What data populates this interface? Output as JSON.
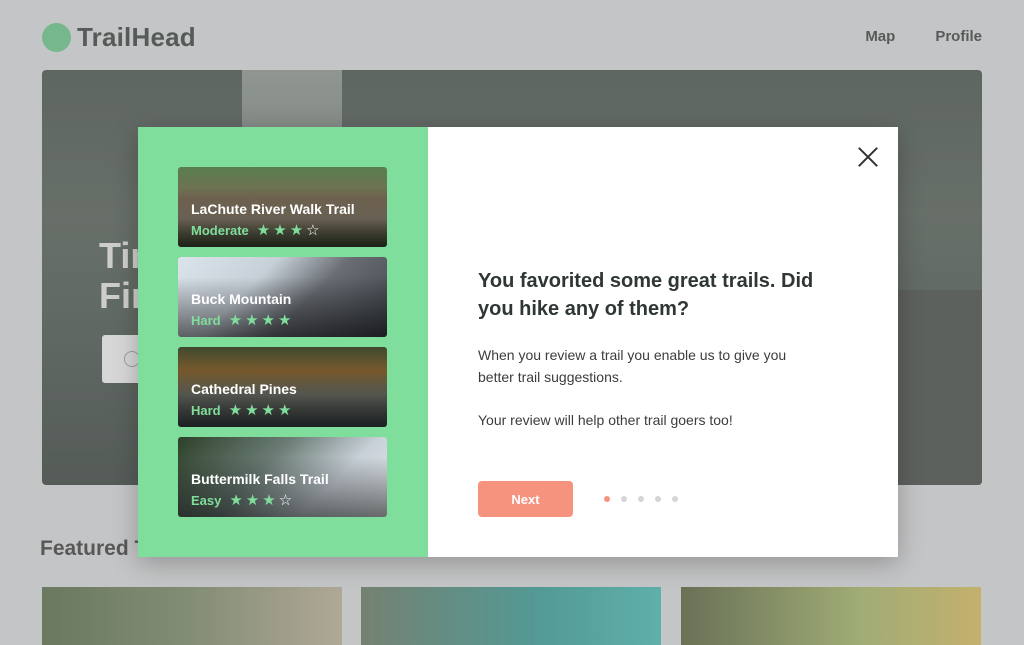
{
  "header": {
    "logo_text": "TrailHead",
    "nav": [
      {
        "label": "Map"
      },
      {
        "label": "Profile"
      }
    ]
  },
  "hero": {
    "title_line1": "Tir",
    "title_line2": "Fir"
  },
  "featured": {
    "heading": "Featured T"
  },
  "modal": {
    "trails": [
      {
        "name": "LaChute River Walk Trail",
        "difficulty": "Moderate",
        "rating": 3,
        "max": 4
      },
      {
        "name": "Buck Mountain",
        "difficulty": "Hard",
        "rating": 4,
        "max": 4
      },
      {
        "name": "Cathedral Pines",
        "difficulty": "Hard",
        "rating": 4,
        "max": 4
      },
      {
        "name": "Buttermilk Falls Trail",
        "difficulty": "Easy",
        "rating": 3,
        "max": 4
      }
    ],
    "title": "You favorited some great trails. Did you hike any of them?",
    "body1": "When you review a trail you enable us to give you better trail suggestions.",
    "body2": "Your review will help other trail goers too!",
    "next_label": "Next",
    "pagination": {
      "total": 5,
      "current": 1
    },
    "colors": {
      "accent": "#f6937f",
      "green": "#80de9c"
    }
  }
}
